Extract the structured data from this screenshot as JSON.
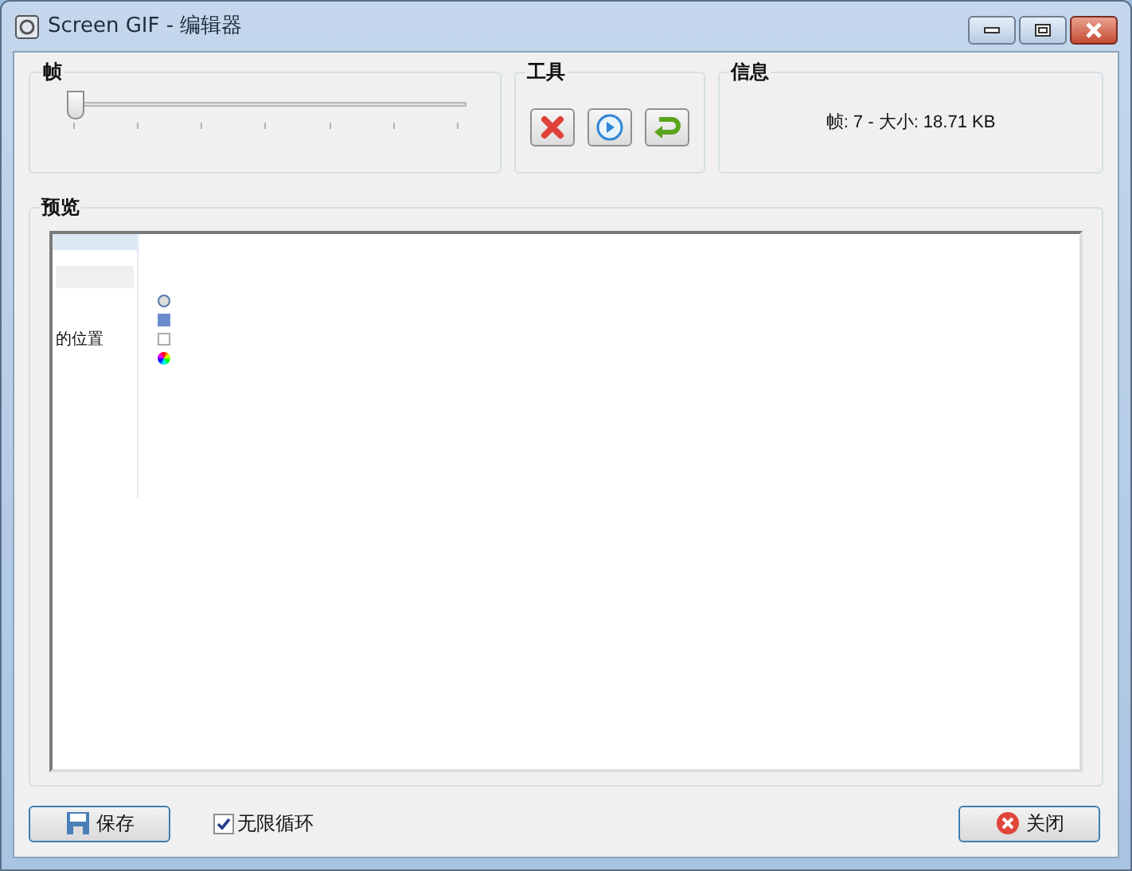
{
  "window": {
    "title": "Screen GIF - 编辑器"
  },
  "frame_group": {
    "title": "帧",
    "slider": {
      "level": 0
    }
  },
  "tools_group": {
    "title": "工具",
    "buttons": [
      {
        "kind": "delete"
      },
      {
        "kind": "play"
      },
      {
        "kind": "undo"
      }
    ]
  },
  "info_group": {
    "title": "信息",
    "text": "帧: 7 - 大小: 18.71 KB"
  },
  "preview": {
    "title": "预览",
    "frame_label": "的位置"
  },
  "save_button": {
    "label": "保存"
  },
  "loop_checkbox": {
    "label": "无限循环",
    "checked": true
  },
  "close_button": {
    "label": "关闭"
  }
}
